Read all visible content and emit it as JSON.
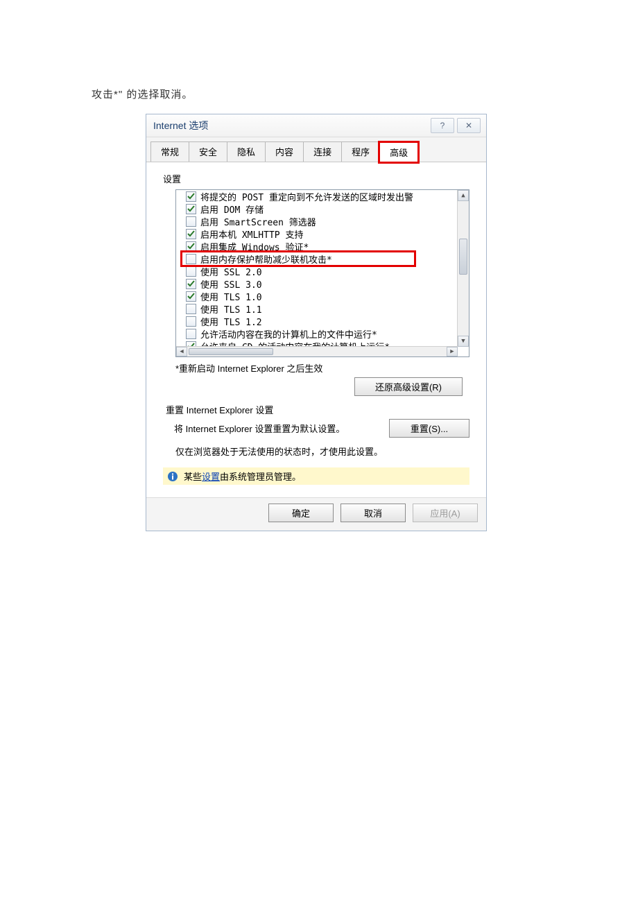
{
  "intro_text": "攻击*\" 的选择取消。",
  "dialog": {
    "title": "Internet 选项",
    "tabs": [
      "常规",
      "安全",
      "隐私",
      "内容",
      "连接",
      "程序",
      "高级"
    ],
    "active_tab": 6,
    "settings_label": "设置",
    "items": [
      {
        "checked": true,
        "label": "将提交的 POST 重定向到不允许发送的区域时发出警"
      },
      {
        "checked": true,
        "label": "启用 DOM 存储"
      },
      {
        "checked": false,
        "label": "启用 SmartScreen 筛选器"
      },
      {
        "checked": true,
        "label": "启用本机 XMLHTTP 支持"
      },
      {
        "checked": true,
        "label": "启用集成 Windows 验证*"
      },
      {
        "checked": false,
        "label": "启用内存保护帮助减少联机攻击*",
        "highlight": true
      },
      {
        "checked": false,
        "label": "使用 SSL 2.0"
      },
      {
        "checked": true,
        "label": "使用 SSL 3.0"
      },
      {
        "checked": true,
        "label": "使用 TLS 1.0"
      },
      {
        "checked": false,
        "label": "使用 TLS 1.1"
      },
      {
        "checked": false,
        "label": "使用 TLS 1.2"
      },
      {
        "checked": false,
        "label": "允许活动内容在我的计算机上的文件中运行*"
      },
      {
        "checked": true,
        "label": "允许来自 CD 的活动内容在我的计算机上运行*"
      }
    ],
    "restart_note": "*重新启动 Internet Explorer 之后生效",
    "restore_btn": "还原高级设置(R)",
    "reset_label": "重置 Internet Explorer 设置",
    "reset_desc": "将 Internet Explorer 设置重置为默认设置。",
    "reset_btn": "重置(S)...",
    "reset_warn": "仅在浏览器处于无法使用的状态时，才使用此设置。",
    "admin_prefix": "某些",
    "admin_link": "设置",
    "admin_suffix": "由系统管理员管理。",
    "ok": "确定",
    "cancel": "取消",
    "apply": "应用(A)"
  }
}
